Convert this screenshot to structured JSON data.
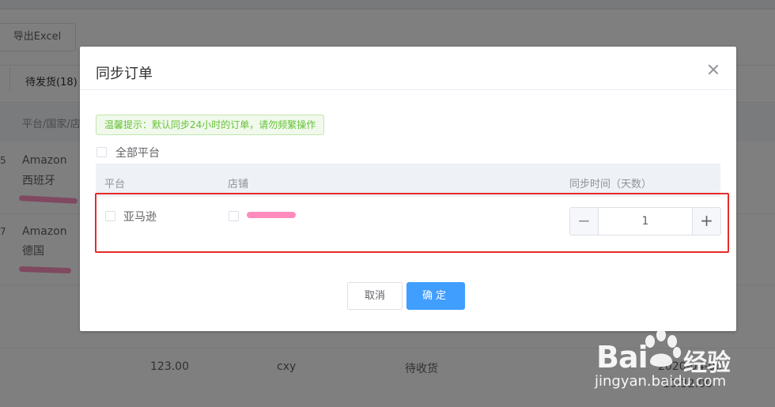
{
  "background": {
    "export_button": "导出Excel",
    "tab": "待发货(18)",
    "table_header": "平台/国家/店",
    "rows": [
      {
        "num": "5",
        "platform": "Amazon",
        "country": "西班牙"
      },
      {
        "num": "7",
        "platform": "Amazon",
        "country": "德国"
      }
    ],
    "bottom_row": {
      "amount": "123.00",
      "user": "cxy",
      "status": "待收货",
      "date": "2020-04-06",
      "time": "10:32:00"
    }
  },
  "dialog": {
    "title": "同步订单",
    "tip": "温馨提示：默认同步24小时的订单，请勿频繁操作",
    "all_platforms_label": "全部平台",
    "columns": {
      "platform": "平台",
      "store": "店铺",
      "sync_time": "同步时间（天数）"
    },
    "row": {
      "platform": "亚马逊",
      "days": "1"
    },
    "stepper": {
      "minus": "−",
      "plus": "+"
    },
    "cancel_label": "取消",
    "confirm_label": "确定"
  },
  "watermark": {
    "brand": "Bai",
    "brand_suffix": "经验",
    "url": "jingyan.baidu.com"
  },
  "colors": {
    "primary": "#409eff",
    "highlight": "#e62c2c",
    "tip_green": "#67c23a"
  }
}
